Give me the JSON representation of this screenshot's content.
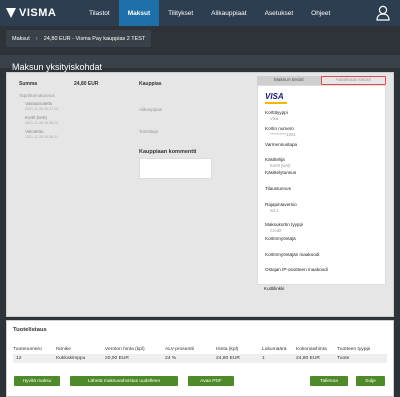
{
  "brand": {
    "name": "VISMA"
  },
  "nav": {
    "items": [
      "Tilastot",
      "Maksut",
      "Tilitykset",
      "Alikauppiaat",
      "Asetukset",
      "Ohjeet"
    ],
    "active": "Maksut"
  },
  "breadcrumb": [
    "Maksut",
    "24,80 EUR - Visma Pay kauppias 2 TEST"
  ],
  "modal": {
    "title": "Maksun yksityiskohdat",
    "summa_label": "Summa",
    "summa_value": "24,80 EUR",
    "events_title": "Tapahtumatunnus",
    "events": [
      {
        "label": "Vastaanotettu",
        "date": "2021-11-26 06:37:29"
      },
      {
        "label": "Kortit (test)",
        "date": "2021-11-26 06:38:23"
      },
      {
        "label": "Veloitettu",
        "date": "2021-11-26 06:38:31"
      }
    ],
    "merchant": {
      "title": "Kauppias",
      "subseller_label": "Alikauppias",
      "supplier_label": "Toimittaja",
      "comment_title": "Kauppiaan kommentti",
      "comment_value": ""
    },
    "tabs": {
      "info": "Maksun tiedot",
      "events": "Asiakkaan tiedot"
    },
    "card": {
      "logo": "VISA",
      "type_label": "Korttityyppi",
      "type_value": "Visa",
      "number_label": "Kortin numero",
      "number_value": "**********1001",
      "verification_label": "Varmennustapa",
      "processor_label": "Käsittelijä",
      "processor_value": "Kortit (test)",
      "processor_id_label": "Käsittelytunnus",
      "order_id_label": "Tilaustunnus",
      "api_label": "Rajapintaversio",
      "api_value": "w3.1",
      "method_type_label": "Maksukortin tyyppi",
      "method_type_value": "Credit",
      "issuer_label": "Kortinmyöntäjä",
      "issuer_country_label": "Kortinmyöntäjän maakoodi",
      "ip_country_label": "Ostajan IP-osoitteen maakoodi",
      "receipt_label": "Kuittilinkki"
    }
  },
  "products": {
    "title": "Tuotelistaus",
    "columns": [
      "Tuotenumero",
      "Nimike",
      "Veroton hinta (kpl)",
      "ALV-prosentti",
      "Hinta (kpl)",
      "Lukumäärä",
      "Kokonaishinta",
      "Tuotteen tyyppi"
    ],
    "rows": [
      [
        "12",
        "Kukkakimppu",
        "20,00 EUR",
        "24 %",
        "24,80 EUR",
        "1",
        "24,80 EUR",
        "Tuote"
      ]
    ]
  },
  "buttons": {
    "refund": "Hyvitä maksu",
    "resend": "Lähetä maksuvahvistus uudelleen",
    "open_pdf": "Avaa PDF",
    "save": "Tallenna",
    "close": "Sulje"
  },
  "colors": {
    "topbar": "#2c3e50",
    "nav_active": "#1f6fa8",
    "button_green": "#4e8a2a",
    "tab_highlight": "#e24a4a"
  }
}
